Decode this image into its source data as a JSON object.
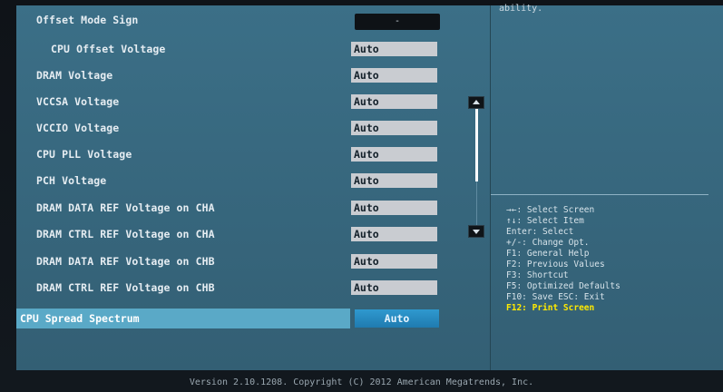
{
  "side_panel": {
    "top_text": "ability.",
    "help_items": [
      "→←: Select Screen",
      "↑↓: Select Item",
      "Enter: Select",
      "+/-: Change Opt.",
      "F1: General Help",
      "F2: Previous Values",
      "F3: Shortcut",
      "F5: Optimized Defaults",
      "F10: Save  ESC: Exit",
      "F12: Print Screen"
    ]
  },
  "settings": {
    "offset_mode_sign": {
      "label": "Offset Mode Sign",
      "value": "-"
    },
    "rows": [
      {
        "label": "CPU Offset Voltage",
        "value": "Auto"
      },
      {
        "label": "DRAM Voltage",
        "value": "Auto"
      },
      {
        "label": "VCCSA Voltage",
        "value": "Auto"
      },
      {
        "label": "VCCIO Voltage",
        "value": "Auto"
      },
      {
        "label": "CPU PLL Voltage",
        "value": "Auto"
      },
      {
        "label": "PCH Voltage",
        "value": "Auto"
      },
      {
        "label": "DRAM DATA REF Voltage on CHA",
        "value": "Auto"
      },
      {
        "label": "DRAM CTRL REF Voltage on CHA",
        "value": "Auto"
      },
      {
        "label": "DRAM DATA REF Voltage on CHB",
        "value": "Auto"
      },
      {
        "label": "DRAM CTRL REF Voltage on CHB",
        "value": "Auto"
      }
    ],
    "selected": {
      "label": "CPU Spread Spectrum",
      "value": "Auto"
    }
  },
  "footer": {
    "text": "Version 2.10.1208. Copyright (C) 2012 American Megatrends, Inc."
  }
}
